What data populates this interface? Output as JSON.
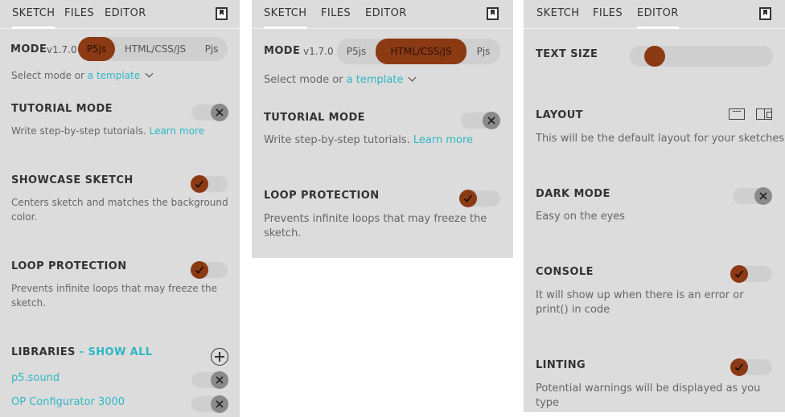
{
  "tabs": {
    "sketch": "SKETCH",
    "files": "FILES",
    "editor": "EDITOR"
  },
  "sketch": {
    "mode_label": "MODE",
    "version": "v1.7.0",
    "modes": [
      "P5js",
      "HTML/CSS/JS",
      "Pjs"
    ],
    "template_prefix": "Select mode or ",
    "template_link": "a template",
    "tutorial": {
      "title": "TUTORIAL MODE",
      "desc": "Write step-by-step tutorials. ",
      "link": "Learn more",
      "enabled": false
    },
    "showcase": {
      "title": "SHOWCASE SKETCH",
      "desc": "Centers sketch and matches the background color.",
      "enabled": true
    },
    "loop": {
      "title": "LOOP PROTECTION",
      "desc": "Prevents infinite loops that may freeze the sketch.",
      "enabled": true
    },
    "libraries": {
      "title": "LIBRARIES",
      "show_all": " - SHOW ALL",
      "items": [
        {
          "name": "p5.sound",
          "enabled": false
        },
        {
          "name": "OP Configurator 3000",
          "enabled": false
        }
      ]
    }
  },
  "panel1": {
    "selected_mode": "P5js"
  },
  "panel2": {
    "selected_mode": "HTML/CSS/JS"
  },
  "editor": {
    "text_size": {
      "title": "TEXT SIZE",
      "level": 0.12
    },
    "layout": {
      "title": "LAYOUT",
      "desc": "This will be the default layout for your sketches"
    },
    "dark_mode": {
      "title": "DARK MODE",
      "desc": "Easy on the eyes",
      "enabled": false
    },
    "console": {
      "title": "CONSOLE",
      "desc": "It will show up when there is an error or print() in code",
      "enabled": true
    },
    "linting": {
      "title": "LINTING",
      "desc": "Potential warnings will be displayed as you type",
      "enabled": true
    }
  },
  "colors": {
    "accent": "#8b3a14",
    "link": "#2fb8c4",
    "panel_bg": "#dcdcdc",
    "toggle_off": "#8a8a8a"
  },
  "icons": {
    "toggle_on": "checkmark-icon",
    "toggle_off": "x-icon",
    "bookmark": "bookmark-icon",
    "add": "plus-circle-icon"
  }
}
